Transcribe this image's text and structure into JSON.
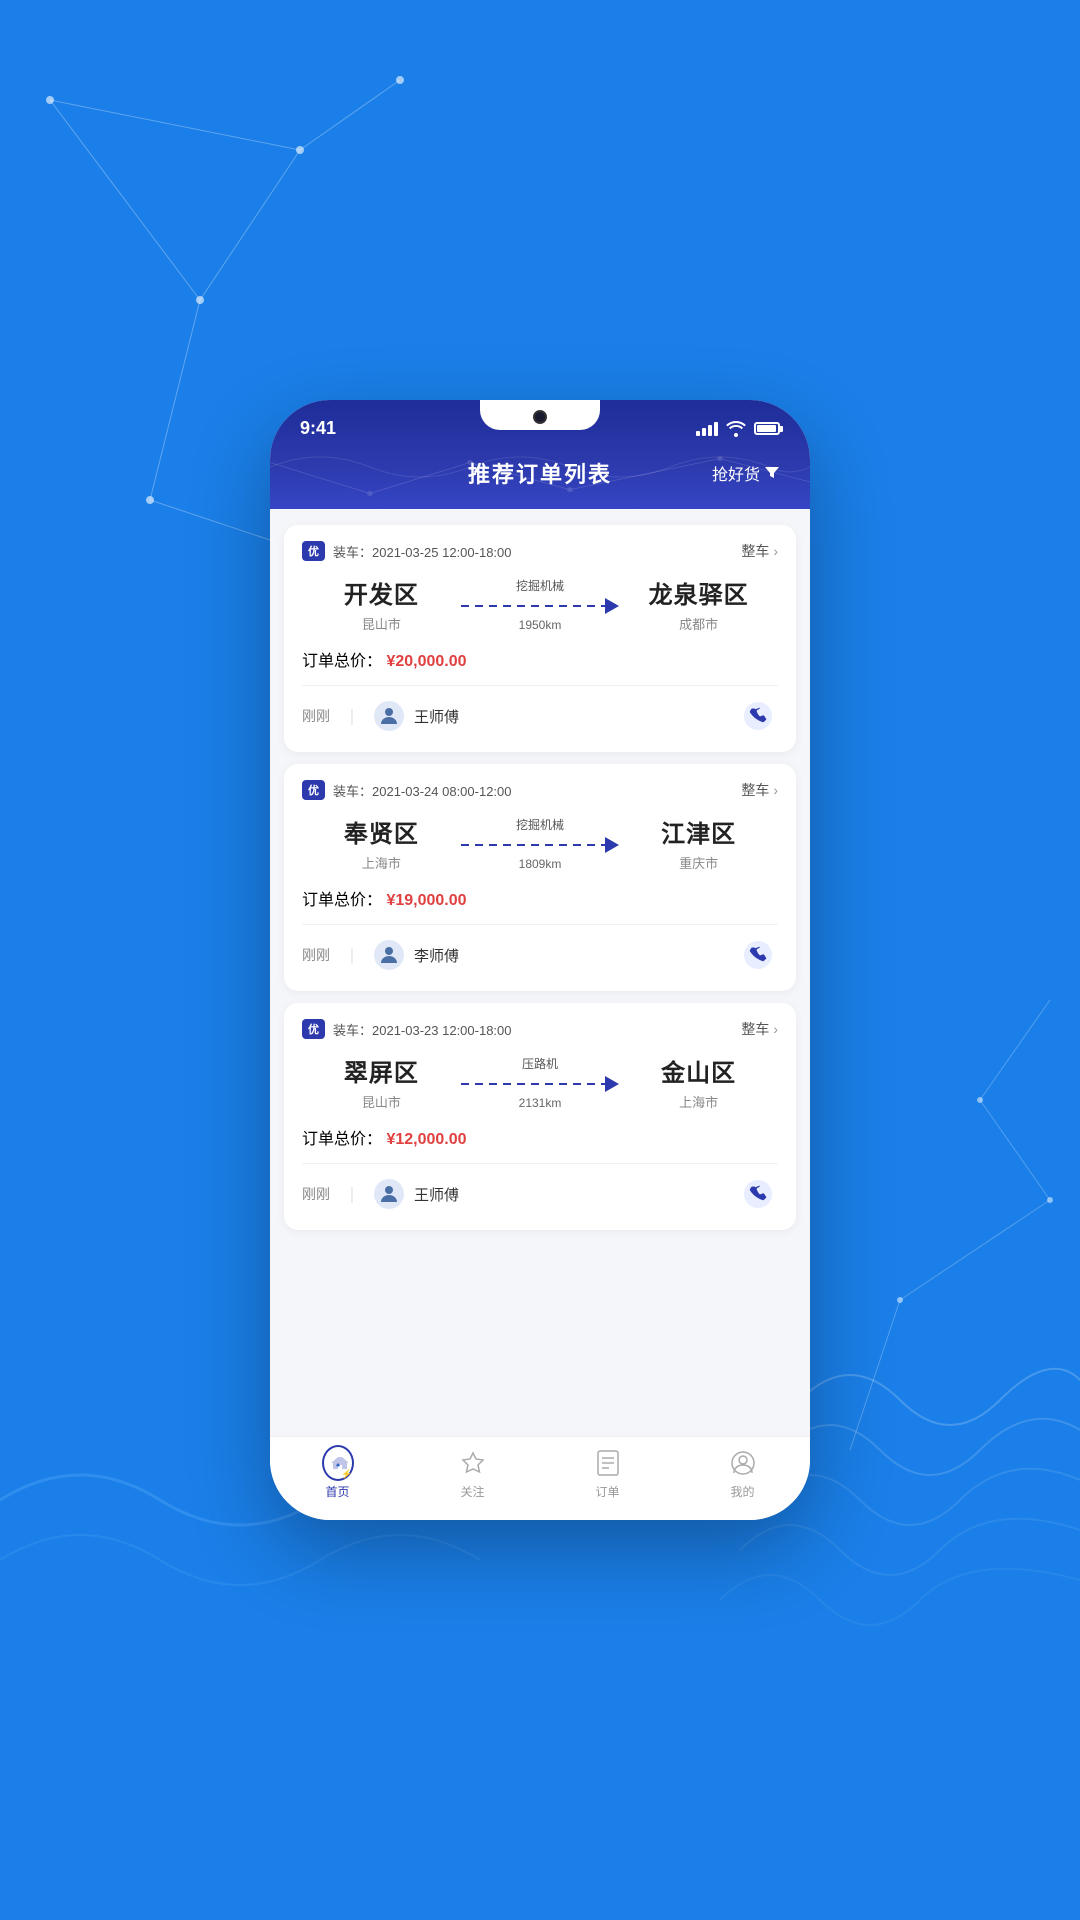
{
  "background": {
    "color": "#1a7fe8"
  },
  "status_bar": {
    "time": "9:41",
    "signal": "signal-icon",
    "wifi": "wifi-icon",
    "battery": "battery-icon"
  },
  "header": {
    "title": "推荐订单列表",
    "action_label": "抢好货",
    "filter_icon": "filter-icon"
  },
  "orders": [
    {
      "id": "order-1",
      "badge": "优",
      "load_time": "装车：2021-03-25 12:00-18:00",
      "type": "整车",
      "from_city": "开发区",
      "from_city_detail": "昆山市",
      "to_city": "龙泉驿区",
      "to_city_detail": "成都市",
      "cargo_type": "挖掘机械",
      "distance": "1950km",
      "price_label": "订单总价：",
      "price": "¥20,000.00",
      "driver_time": "刚刚",
      "driver_name": "王师傅",
      "phone_icon": "phone-icon"
    },
    {
      "id": "order-2",
      "badge": "优",
      "load_time": "装车：2021-03-24 08:00-12:00",
      "type": "整车",
      "from_city": "奉贤区",
      "from_city_detail": "上海市",
      "to_city": "江津区",
      "to_city_detail": "重庆市",
      "cargo_type": "挖掘机械",
      "distance": "1809km",
      "price_label": "订单总价：",
      "price": "¥19,000.00",
      "driver_time": "刚刚",
      "driver_name": "李师傅",
      "phone_icon": "phone-icon"
    },
    {
      "id": "order-3",
      "badge": "优",
      "load_time": "装车：2021-03-23 12:00-18:00",
      "type": "整车",
      "from_city": "翠屏区",
      "from_city_detail": "昆山市",
      "to_city": "金山区",
      "to_city_detail": "上海市",
      "cargo_type": "压路机",
      "distance": "2131km",
      "price_label": "订单总价：",
      "price": "¥12,000.00",
      "driver_time": "刚刚",
      "driver_name": "王师傅",
      "phone_icon": "phone-icon"
    }
  ],
  "bottom_nav": {
    "items": [
      {
        "id": "home",
        "label": "首页",
        "icon": "home-icon",
        "active": true
      },
      {
        "id": "follow",
        "label": "关注",
        "icon": "follow-icon",
        "active": false
      },
      {
        "id": "orders",
        "label": "订单",
        "icon": "orders-icon",
        "active": false
      },
      {
        "id": "mine",
        "label": "我的",
        "icon": "mine-icon",
        "active": false
      }
    ]
  }
}
